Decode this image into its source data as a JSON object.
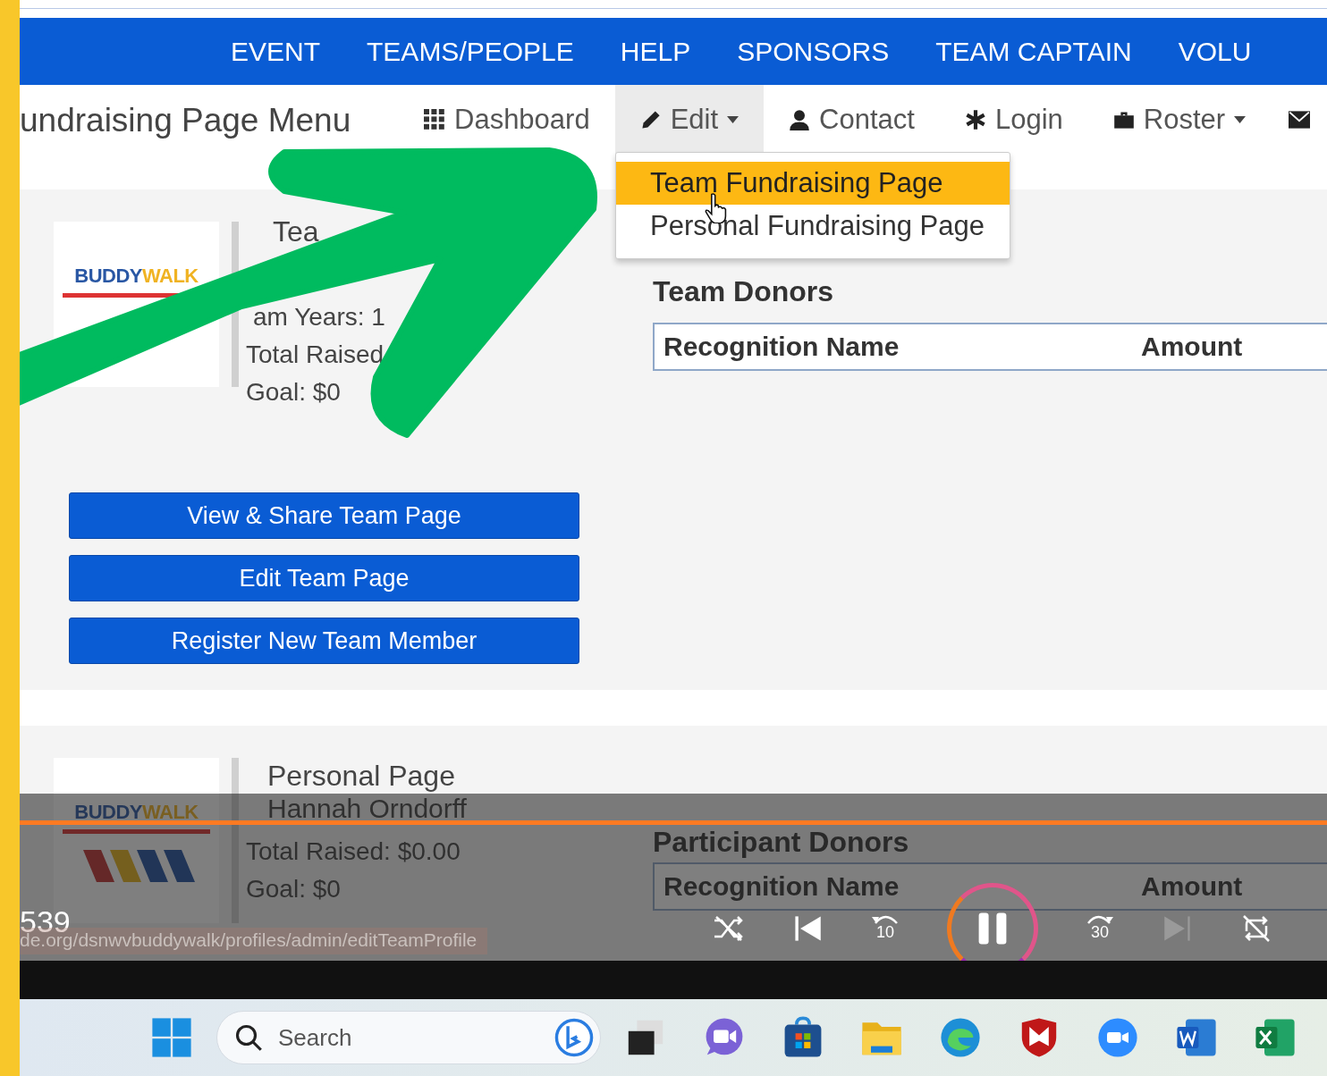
{
  "nav": {
    "items": [
      "EVENT",
      "TEAMS/PEOPLE",
      "HELP",
      "SPONSORS",
      "TEAM CAPTAIN",
      "VOLU"
    ]
  },
  "menu": {
    "title": "undraising Page Menu",
    "items": [
      {
        "label": "Dashboard",
        "selected": false,
        "dropdown": false
      },
      {
        "label": "Edit",
        "selected": true,
        "dropdown": true
      },
      {
        "label": "Contact",
        "selected": false,
        "dropdown": false
      },
      {
        "label": "Login",
        "selected": false,
        "dropdown": false
      },
      {
        "label": "Roster",
        "selected": false,
        "dropdown": true
      }
    ]
  },
  "edit_dropdown": {
    "items": [
      {
        "label": "Team Fundraising Page",
        "selected": true
      },
      {
        "label": "Personal Fundraising Page",
        "selected": false
      }
    ]
  },
  "team_card": {
    "logo": [
      "BUDDY",
      "WALK"
    ],
    "title": "Tea",
    "lines": [
      "am Years: 1",
      "Total Raised",
      "Goal: $0"
    ]
  },
  "buttons": [
    "View & Share Team Page",
    "Edit Team Page",
    "Register New Team Member"
  ],
  "team_donors": {
    "title": "Team Donors",
    "columns": [
      "Recognition Name",
      "Amount"
    ]
  },
  "personal_card": {
    "logo": [
      "BUDDY",
      "WALK"
    ],
    "title": "Personal Page",
    "name": "Hannah Orndorff",
    "lines": [
      "Total Raised: $0.00",
      "Goal: $0"
    ]
  },
  "participant_donors": {
    "title": "Participant Donors",
    "columns": [
      "Recognition Name",
      "Amount"
    ]
  },
  "video_player": {
    "time": "539",
    "status_url": "de.org/dsnwvbuddywalk/profiles/admin/editTeamProfile",
    "playing": true,
    "level": 1,
    "rewind": "10",
    "forward": "30"
  },
  "taskbar": {
    "search": {
      "placeholder": "Search"
    }
  }
}
